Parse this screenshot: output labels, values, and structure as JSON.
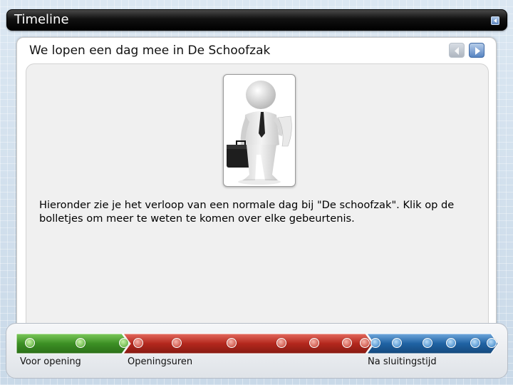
{
  "window": {
    "title": "Timeline"
  },
  "slide": {
    "heading": "We lopen een dag mee in De Schoofzak",
    "intro": "Hieronder zie je het verloop van een normale dag bij \"De schoofzak\". Klik op de bolletjes om meer te weten te komen over elke gebeurtenis."
  },
  "timeline": {
    "segments": [
      {
        "label": "Voor opening",
        "color": "#3c8f24"
      },
      {
        "label": "Openingsuren",
        "color": "#b3271d"
      },
      {
        "label": "Na sluitingstijd",
        "color": "#1f62a3"
      }
    ]
  },
  "icons": {
    "prev": "prev-arrow-icon",
    "next": "next-arrow-icon",
    "window_control": "back-icon"
  }
}
